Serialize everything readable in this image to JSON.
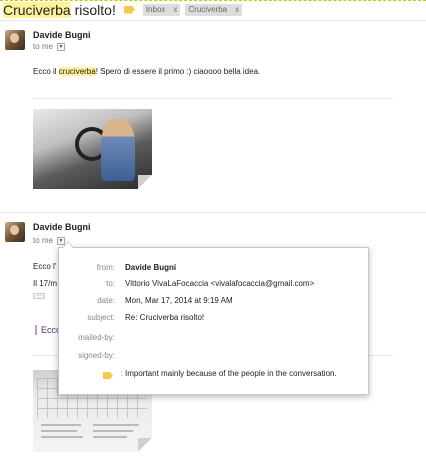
{
  "subject": {
    "title_highlight": "Cruciverba",
    "title_rest": " risolto!",
    "labels": [
      {
        "name": "Inbox",
        "close": "x"
      },
      {
        "name": "Cruciverba",
        "close": "x"
      }
    ]
  },
  "message1": {
    "sender": "Davide Bugni",
    "to": "to me",
    "body_pre": "Ecco il ",
    "body_hl": "cruciverba",
    "body_post": "! Spero di essere il primo :) ciaoooo bella idea."
  },
  "message2": {
    "sender": "Davide Bugni",
    "to": "to me",
    "body_line1": "Ecco l'",
    "body_line2": "Il 17/m",
    "quoted_toggle": "...",
    "quoted_snippet": "Ecco"
  },
  "details": {
    "from_label": "from:",
    "from_value": "Davide Bugni",
    "to_label": "to:",
    "to_value": "Vittorio VivaLaFocaccia <vivalafocaccia@gmail.com>",
    "date_label": "date:",
    "date_value": "Mon, Mar 17, 2014 at 9:19 AM",
    "subject_label": "subject:",
    "subject_value": "Re: Cruciverba risolto!",
    "mailedby_label": "mailed-by:",
    "signedby_label": "signed-by:",
    "importance_sep": ":",
    "importance_value": "Important mainly because of the people in the conversation."
  },
  "colors": {
    "highlight": "#fff29a",
    "importance": "#f6c94a",
    "label_chip": "#dddddd"
  }
}
